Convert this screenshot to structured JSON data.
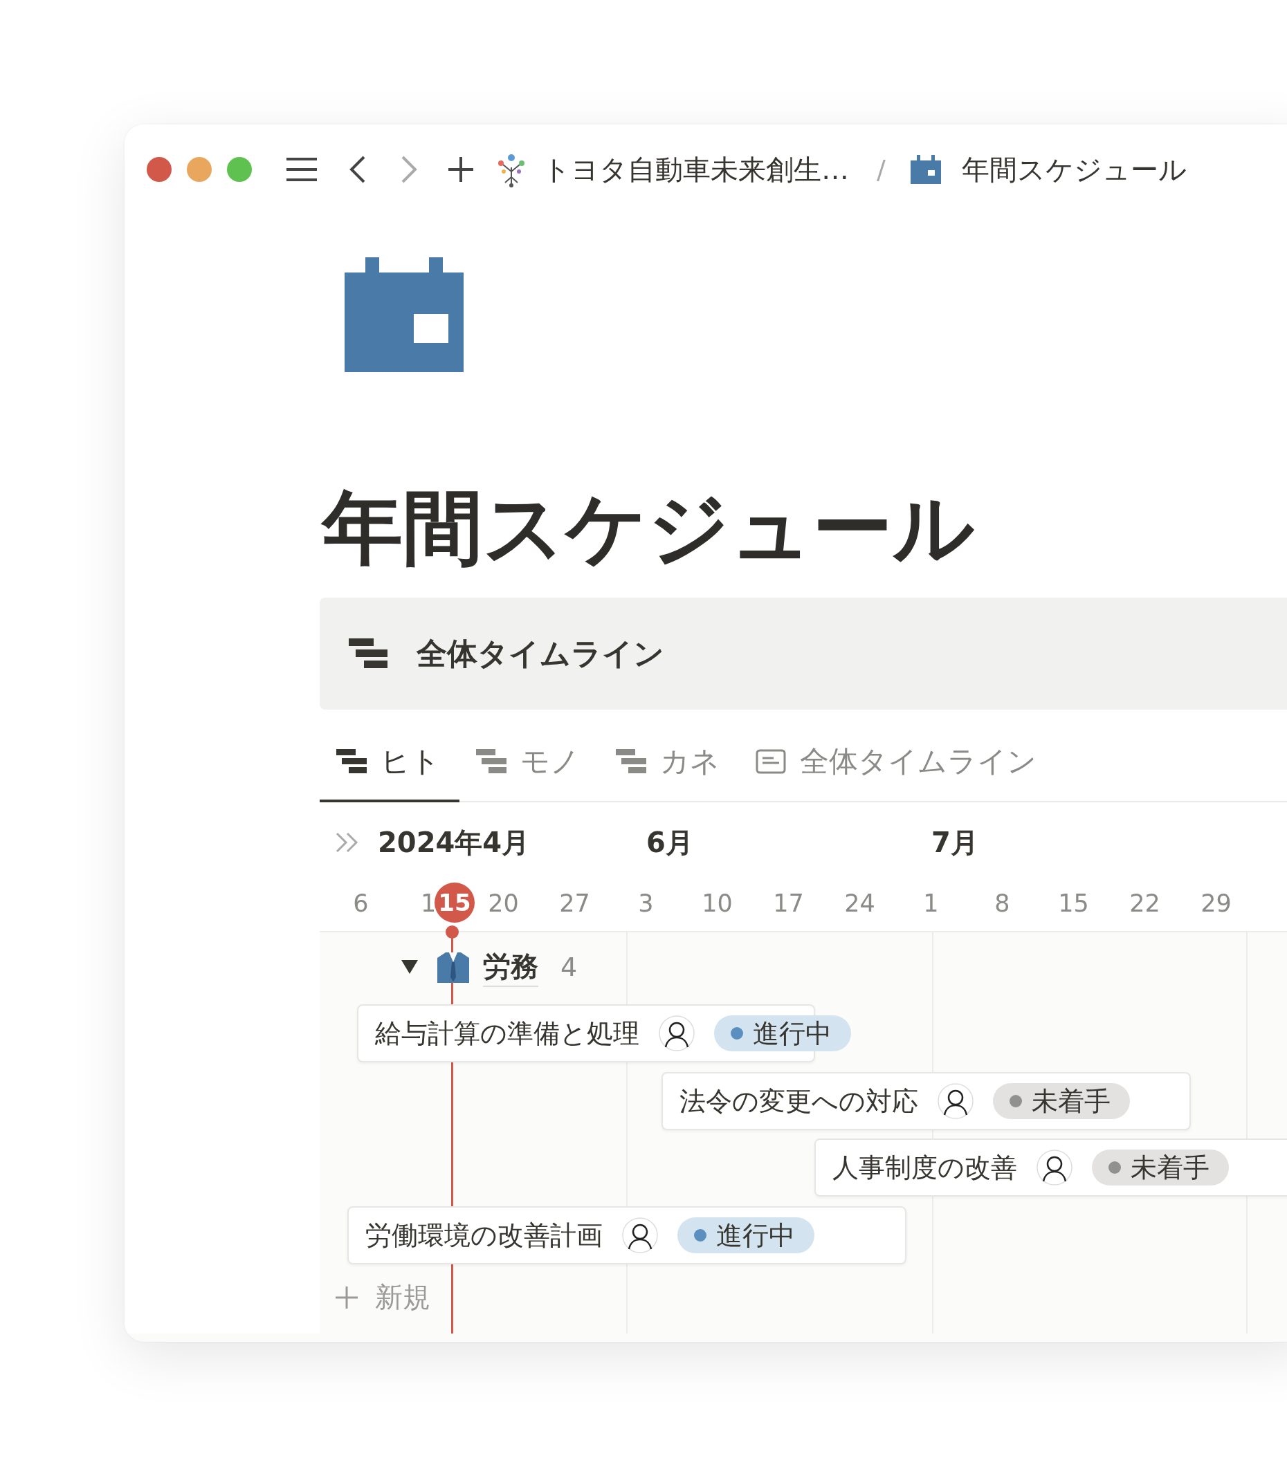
{
  "breadcrumb": [
    {
      "label": "トヨタ自動車未来創生…",
      "kind": "workspace"
    },
    {
      "label": "/",
      "kind": "separator"
    },
    {
      "label": "年間スケジュール",
      "kind": "page"
    }
  ],
  "title": "年間スケジュール",
  "view_banner": {
    "label": "全体タイムライン"
  },
  "tabs": [
    {
      "label": "ヒト",
      "kind": "timeline",
      "selected": true
    },
    {
      "label": "モノ",
      "kind": "timeline",
      "selected": false
    },
    {
      "label": "カネ",
      "kind": "timeline",
      "selected": false
    },
    {
      "label": "全体タイムライン",
      "kind": "list",
      "selected": false
    }
  ],
  "timeline": {
    "months": [
      "2024年4月",
      "6月",
      "7月"
    ],
    "dates": [
      "6",
      "1",
      "20",
      "27",
      "3",
      "10",
      "17",
      "24",
      "1",
      "8",
      "15",
      "22",
      "29"
    ],
    "today": "15",
    "group": {
      "label": "労務",
      "count": "4",
      "expanded": true
    },
    "items": [
      {
        "title": "給与計算の準備と処理",
        "status": {
          "label": "進行中",
          "kind": "in_progress"
        }
      },
      {
        "title": "法令の変更への対応",
        "status": {
          "label": "未着手",
          "kind": "not_started"
        }
      },
      {
        "title": "人事制度の改善",
        "status": {
          "label": "未着手",
          "kind": "not_started"
        }
      },
      {
        "title": "労働環境の改善計画",
        "status": {
          "label": "進行中",
          "kind": "in_progress"
        }
      }
    ],
    "new_label": "新規"
  }
}
